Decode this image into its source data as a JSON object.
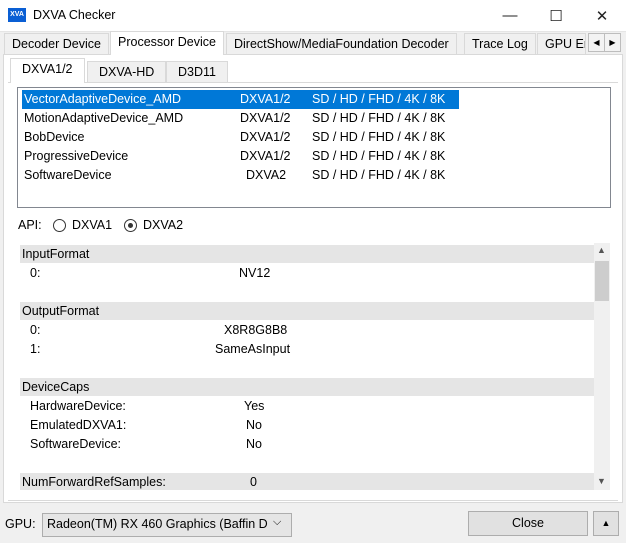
{
  "window": {
    "title": "DXVA Checker",
    "icon_text": "XVA",
    "minimize": "—",
    "maximize": "☐",
    "close": "✕"
  },
  "main_tabs": [
    "Decoder Device",
    "Processor Device",
    "DirectShow/MediaFoundation Decoder",
    "Trace Log",
    "GPU En"
  ],
  "main_active": "Processor Device",
  "sub_tabs": [
    "DXVA1/2",
    "DXVA-HD",
    "D3D11"
  ],
  "devices": [
    {
      "name": "VectorAdaptiveDevice_AMD",
      "api": "DXVA1/2",
      "res": "SD / HD / FHD / 4K / 8K"
    },
    {
      "name": "MotionAdaptiveDevice_AMD",
      "api": "DXVA1/2",
      "res": "SD / HD / FHD / 4K / 8K"
    },
    {
      "name": "BobDevice",
      "api": "DXVA1/2",
      "res": "SD / HD / FHD / 4K / 8K"
    },
    {
      "name": "ProgressiveDevice",
      "api": "DXVA1/2",
      "res": "SD / HD / FHD / 4K / 8K"
    },
    {
      "name": "SoftwareDevice",
      "api": "DXVA2",
      "res": "SD / HD / FHD / 4K / 8K"
    }
  ],
  "api": {
    "label": "API:",
    "opt1": "DXVA1",
    "opt2": "DXVA2",
    "selected": "DXVA2"
  },
  "details": {
    "input_header": "InputFormat",
    "input_key0": "0:",
    "input_val0": "NV12",
    "output_header": "OutputFormat",
    "output_key0": "0:",
    "output_val0": "X8R8G8B8",
    "output_key1": "1:",
    "output_val1": "SameAsInput",
    "caps_header": "DeviceCaps",
    "caps_k1": "HardwareDevice:",
    "caps_v1": "Yes",
    "caps_k2": "EmulatedDXVA1:",
    "caps_v2": "No",
    "caps_k3": "SoftwareDevice:",
    "caps_v3": "No",
    "nfr_header": "NumForwardRefSamples:",
    "nfr_val": "0"
  },
  "bottom": {
    "gpu_label": "GPU:",
    "gpu_value": "Radeon(TM) RX 460 Graphics (Baffin D",
    "close_label": "Close",
    "up_label": "▲"
  }
}
